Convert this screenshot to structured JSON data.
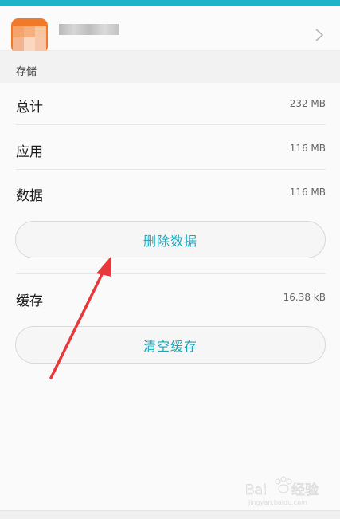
{
  "app_header": {
    "app_name": "",
    "icon": "app-icon",
    "chevron_icon": "chevron-right-icon"
  },
  "storage": {
    "section_title": "存储",
    "total": {
      "label": "总计",
      "value": "232 MB"
    },
    "app": {
      "label": "应用",
      "value": "116 MB"
    },
    "data": {
      "label": "数据",
      "value": "116 MB"
    },
    "clear_data_button": "删除数据",
    "cache": {
      "label": "缓存",
      "value": "16.38 kB"
    },
    "clear_cache_button": "清空缓存"
  },
  "annotation": {
    "icon": "red-arrow-icon",
    "color": "#e8383c"
  },
  "watermark": {
    "text": "Baidu经验",
    "subtext": "jingyan.baidu.com"
  },
  "colors": {
    "accent": "#1aa6b9",
    "top_stripe": "#1fb3c9",
    "arrow": "#e8383c",
    "app_icon": "#f07a2a"
  }
}
